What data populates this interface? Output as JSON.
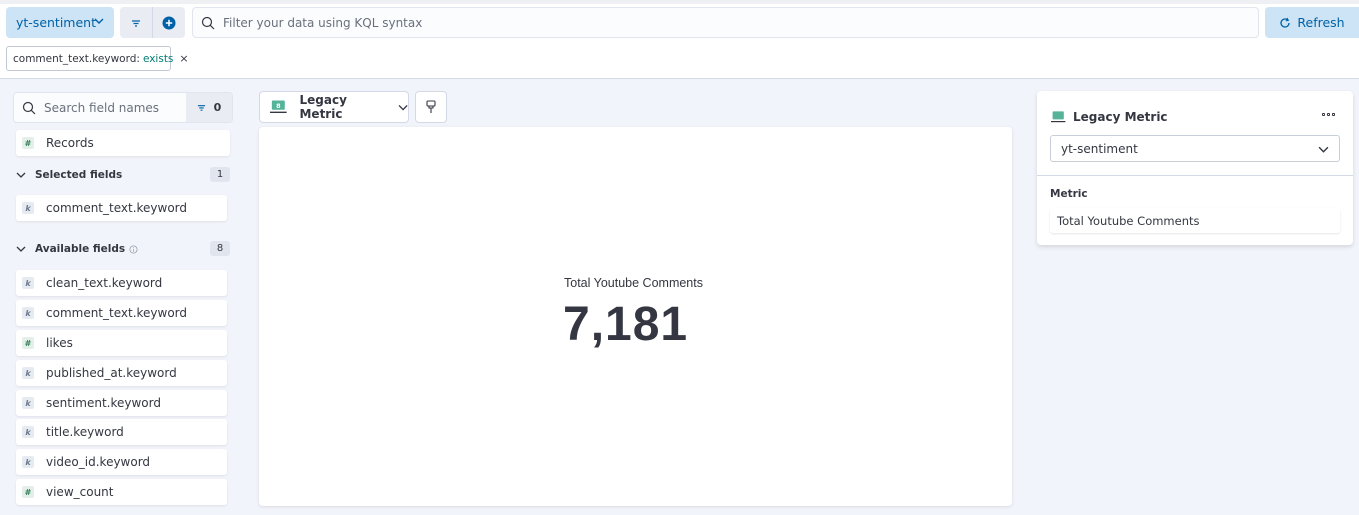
{
  "header": {
    "data_view": "yt-sentiment",
    "search": {
      "placeholder": "Filter your data using KQL syntax",
      "value": ""
    },
    "refresh_label": "Refresh"
  },
  "filter_pill": {
    "field": "comment_text.keyword:",
    "operator": "exists"
  },
  "field_list": {
    "search_placeholder": "Search field names",
    "filter_count": "0",
    "records_label": "Records",
    "selected": {
      "title": "Selected fields",
      "count": "1",
      "items": [
        {
          "name": "comment_text.keyword",
          "type": "k"
        }
      ]
    },
    "available": {
      "title": "Available fields",
      "count": "8",
      "items": [
        {
          "name": "clean_text.keyword",
          "type": "k"
        },
        {
          "name": "comment_text.keyword",
          "type": "k"
        },
        {
          "name": "likes",
          "type": "#"
        },
        {
          "name": "published_at.keyword",
          "type": "k"
        },
        {
          "name": "sentiment.keyword",
          "type": "k"
        },
        {
          "name": "title.keyword",
          "type": "k"
        },
        {
          "name": "video_id.keyword",
          "type": "k"
        },
        {
          "name": "view_count",
          "type": "#"
        }
      ]
    }
  },
  "workspace": {
    "vis_type": "Legacy Metric",
    "metric_label": "Total Youtube Comments",
    "metric_value": "7,181"
  },
  "config": {
    "title": "Legacy Metric",
    "data_view": "yt-sentiment",
    "section": "Metric",
    "dimension_label": "Total Youtube Comments"
  },
  "colors": {
    "accent": "#0061a6",
    "accent_bg": "#cce4f5",
    "workspace_bg": "#f1f4fa",
    "success_text": "#017d73"
  }
}
